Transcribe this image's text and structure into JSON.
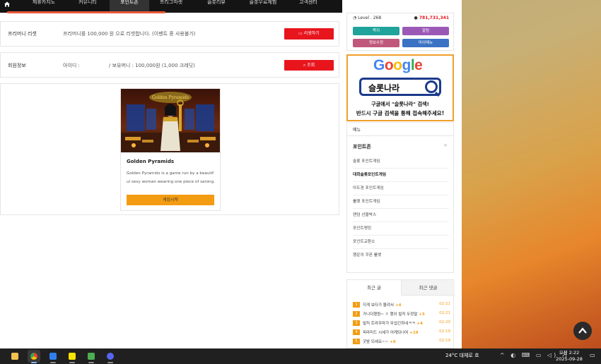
{
  "nav": {
    "home_icon": "home-icon",
    "items": [
      "제휴카지노",
      "커뮤니티",
      "포인트존",
      "프리그마켓",
      "슬롯리뷰",
      "슬롯무료체험",
      "고객센터"
    ],
    "active_index": 2,
    "bell_icon": "bell-icon",
    "grid_icon": "grid-icon"
  },
  "free_money": {
    "label": "프리머니 리셋",
    "text": "프리머니를 100,000 원 으로 리셋합니다. (이벤트 중 사용불가)",
    "button": "리셋하기"
  },
  "member": {
    "label": "회원정보",
    "id_label": "아이디 :",
    "money_text": "/ 보유머니 : 100,000원 (1,000 크레딧)",
    "button": "조회"
  },
  "game": {
    "thumb_title": "Golden Pyramids",
    "title": "Golden Pyramids",
    "description": "Golden Pyramids is a game run by a beautiful sexy woman wearing one piece of sarong.",
    "play_button": "게임시작"
  },
  "user": {
    "level": "Level . 268",
    "money": "781,731,341",
    "buttons": [
      "쪽지",
      "알림",
      "정보수정",
      "마이메뉴"
    ],
    "button_colors": [
      "#1fa39a",
      "#9b59b6",
      "#c0587b",
      "#3b73c4"
    ]
  },
  "banner": {
    "google": "Google",
    "search_text": "슬롯나라",
    "line1": "구글에서 \"슬롯나라\" 검색!",
    "line2": "반드시 구글 검색을 통해 접속해주세요!"
  },
  "menu": {
    "header": "메뉴",
    "section": "포인트존",
    "plus": "+",
    "items": [
      "슬롯 포인트게임",
      "대회슬롯포인트게임",
      "아도겐 포인트게임",
      "룰렛 포인트게임",
      "랜덤 선물박스",
      "포인트랭킹",
      "포인트교환소",
      "행운의 쿠폰 룰렛"
    ],
    "bold_index": 1
  },
  "recent": {
    "tabs": [
      "최근 글",
      "최근 댓글"
    ],
    "posts": [
      {
        "num": "1",
        "title": "지게 보다가 몰려서",
        "count": "+4",
        "time": "02:21"
      },
      {
        "num": "2",
        "title": "가니다했됨~ ㅈ 했이 빌직 두깡말",
        "count": "+5",
        "time": "02:21"
      },
      {
        "num": "3",
        "title": "빌직 트라우마가 무섭긴하네ㅋㅋ",
        "count": "+4",
        "time": "02:20"
      },
      {
        "num": "4",
        "title": "피라미드 시세가 어케되나여",
        "count": "+19",
        "time": "02:19"
      },
      {
        "num": "5",
        "title": "굿밤 되세요~~",
        "count": "+6",
        "time": "02:19"
      }
    ]
  },
  "taskbar": {
    "apps": [
      "file-explorer-icon",
      "chrome-icon",
      "messenger-icon",
      "kakaotalk-icon",
      "notes-icon",
      "discord-icon"
    ],
    "weather": "24°C  대체로 흐",
    "tray": "^ ◐ ⌨ ▭ ◁) 가",
    "time": "오전 2:22",
    "date": "2025-09-28"
  },
  "colors": {
    "accent_red": "#e8151d",
    "orange": "#f39c12",
    "nav_bg": "#141414"
  }
}
